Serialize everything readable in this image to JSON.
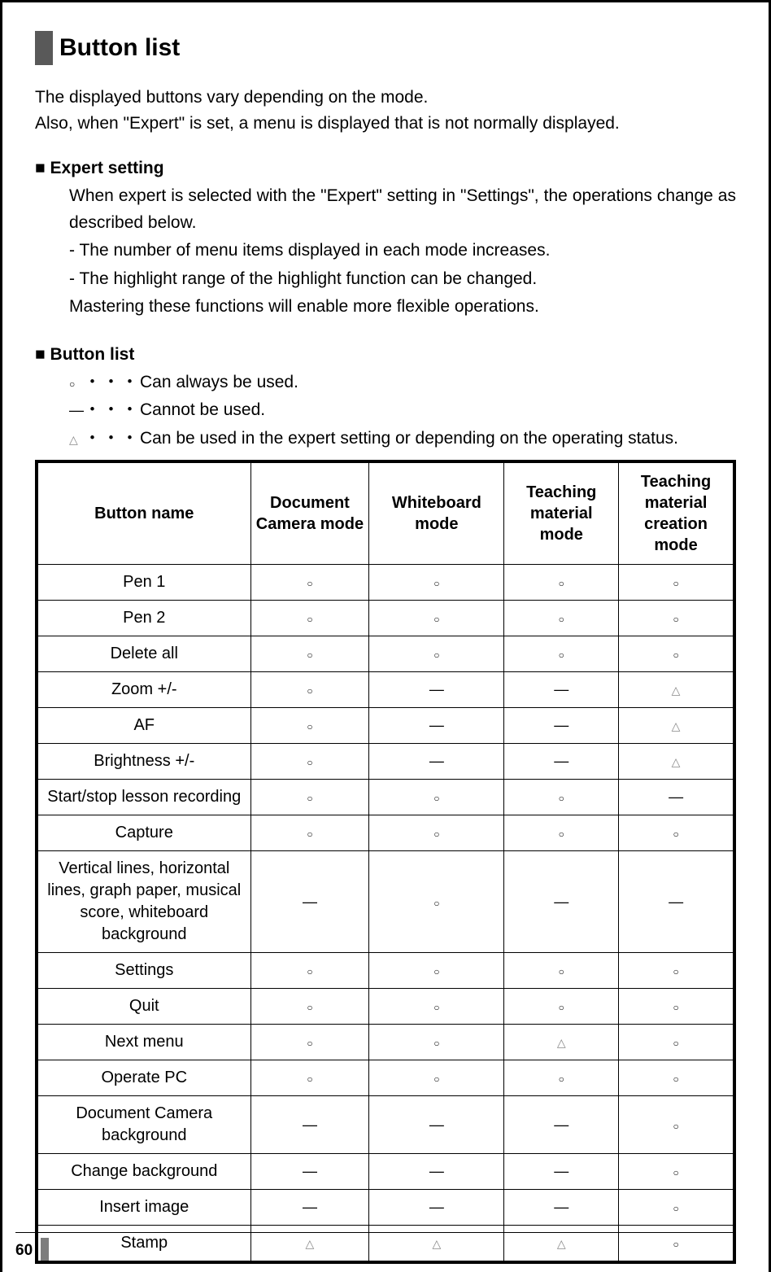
{
  "title": "Button list",
  "intro_line1": "The displayed buttons vary depending on the mode.",
  "intro_line2": "Also, when \"Expert\" is set, a menu is displayed that is not normally displayed.",
  "expert_heading": "Expert setting",
  "expert_body": {
    "p1": "When expert is selected with the \"Expert\" setting in \"Settings\", the operations change as described below.",
    "p2": "- The number of menu items displayed in each mode increases.",
    "p3": "- The highlight range of the highlight function can be changed.",
    "p4": "Mastering these functions will enable more flexible operations."
  },
  "buttonlist_heading": "Button list",
  "legend": {
    "always": {
      "sym": "○",
      "dots": "・・・",
      "text": "Can always be used."
    },
    "cannot": {
      "sym": "―",
      "dots": "・・・",
      "text": "Cannot be used."
    },
    "expert": {
      "sym": "△",
      "dots": "・・・",
      "text": "Can be used in the expert setting or depending on the operating status."
    }
  },
  "table": {
    "headers": {
      "name": "Button name",
      "doc": "Document Camera mode",
      "wb": "Whiteboard mode",
      "tm": "Teaching material mode",
      "tmc": "Teaching material creation mode"
    },
    "symbols": {
      "yes": "○",
      "no": "―",
      "tri": "△"
    },
    "rows": [
      {
        "name": "Pen 1",
        "cells": [
          "yes",
          "yes",
          "yes",
          "yes"
        ]
      },
      {
        "name": "Pen 2",
        "cells": [
          "yes",
          "yes",
          "yes",
          "yes"
        ]
      },
      {
        "name": "Delete all",
        "cells": [
          "yes",
          "yes",
          "yes",
          "yes"
        ]
      },
      {
        "name": "Zoom +/-",
        "cells": [
          "yes",
          "no",
          "no",
          "tri"
        ]
      },
      {
        "name": "AF",
        "cells": [
          "yes",
          "no",
          "no",
          "tri"
        ]
      },
      {
        "name": "Brightness +/-",
        "cells": [
          "yes",
          "no",
          "no",
          "tri"
        ]
      },
      {
        "name": "Start/stop lesson recording",
        "cells": [
          "yes",
          "yes",
          "yes",
          "no"
        ]
      },
      {
        "name": "Capture",
        "cells": [
          "yes",
          "yes",
          "yes",
          "yes"
        ]
      },
      {
        "name": "Vertical lines, horizontal lines, graph paper, musical score, whiteboard background",
        "cells": [
          "no",
          "yes",
          "no",
          "no"
        ]
      },
      {
        "name": "Settings",
        "cells": [
          "yes",
          "yes",
          "yes",
          "yes"
        ]
      },
      {
        "name": "Quit",
        "cells": [
          "yes",
          "yes",
          "yes",
          "yes"
        ]
      },
      {
        "name": "Next menu",
        "cells": [
          "yes",
          "yes",
          "tri",
          "yes"
        ]
      },
      {
        "name": "Operate PC",
        "cells": [
          "yes",
          "yes",
          "yes",
          "yes"
        ]
      },
      {
        "name": "Document Camera background",
        "cells": [
          "no",
          "no",
          "no",
          "yes"
        ]
      },
      {
        "name": "Change background",
        "cells": [
          "no",
          "no",
          "no",
          "yes"
        ]
      },
      {
        "name": "Insert image",
        "cells": [
          "no",
          "no",
          "no",
          "yes"
        ]
      },
      {
        "name": "Stamp",
        "cells": [
          "tri",
          "tri",
          "tri",
          "yes"
        ]
      }
    ]
  },
  "page_number": "60"
}
